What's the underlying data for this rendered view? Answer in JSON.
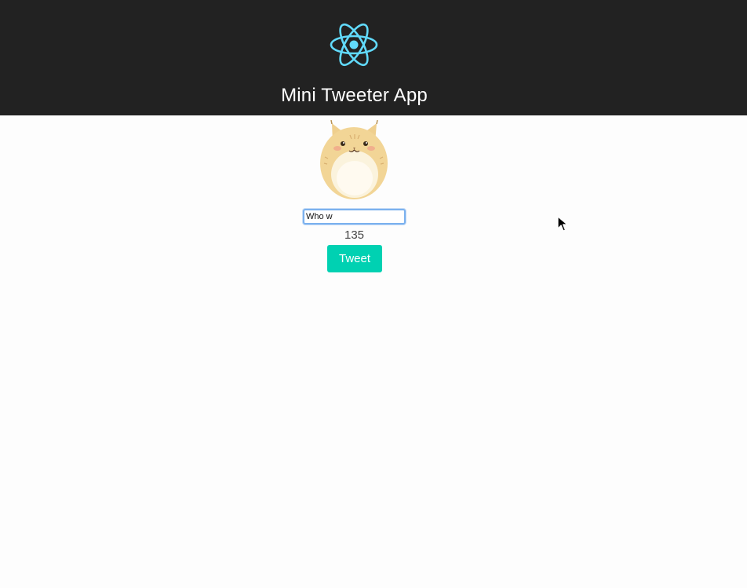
{
  "header": {
    "title": "Mini Tweeter App",
    "logo_icon": "react-atom-icon",
    "background_color": "#222222",
    "logo_color": "#61dafb"
  },
  "profile": {
    "avatar_icon": "cat-avatar"
  },
  "composer": {
    "input_value": "Who w",
    "char_count": "135",
    "tweet_button_label": "Tweet",
    "button_color": "#00d1b2"
  }
}
